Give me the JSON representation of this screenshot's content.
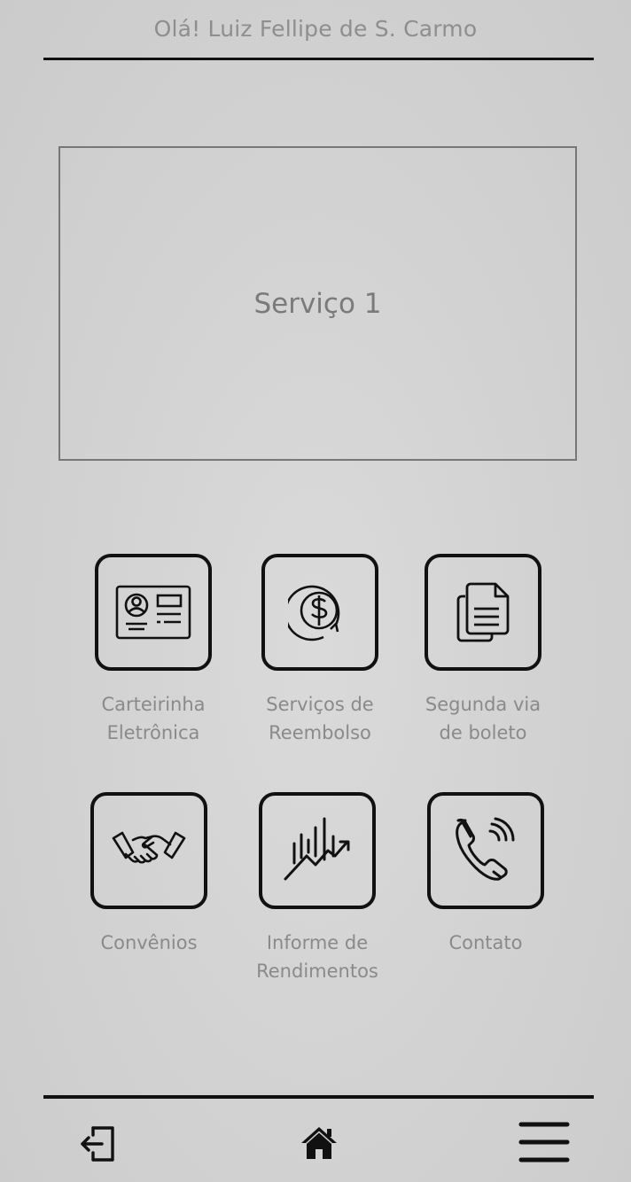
{
  "header": {
    "greeting": "Olá! Luiz Fellipe de S. Carmo"
  },
  "banner": {
    "label": "Serviço 1"
  },
  "services": [
    {
      "label": "Carteirinha\nEletrônica",
      "icon": "id-card-icon"
    },
    {
      "label": "Serviços de\nReembolso",
      "icon": "refund-icon"
    },
    {
      "label": "Segunda via\nde boleto",
      "icon": "documents-icon"
    },
    {
      "label": "Convênios",
      "icon": "handshake-icon"
    },
    {
      "label": "Informe de\nRendimentos",
      "icon": "growth-chart-icon"
    },
    {
      "label": "Contato",
      "icon": "phone-icon"
    }
  ],
  "bottom_nav": {
    "items": [
      "logout-icon",
      "home-icon",
      "menu-icon"
    ]
  }
}
